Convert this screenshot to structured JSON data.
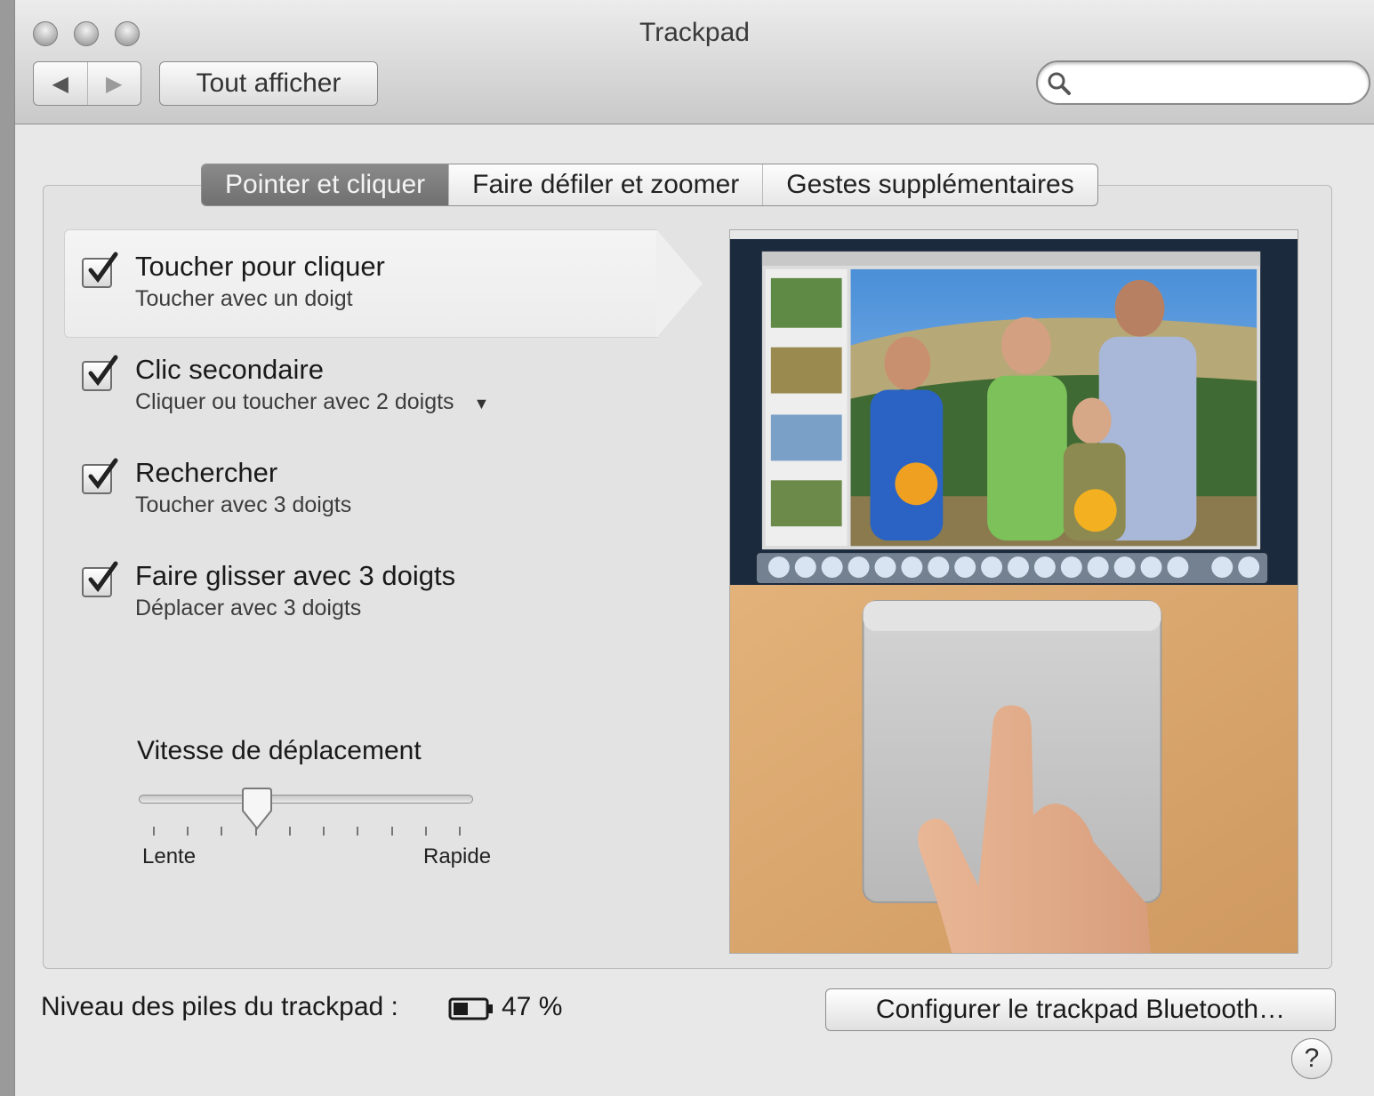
{
  "window": {
    "title": "Trackpad"
  },
  "toolbar": {
    "back_glyph": "◀",
    "forward_glyph": "▶",
    "show_all_label": "Tout afficher",
    "search_placeholder": "",
    "search_icon": "magnifier-icon"
  },
  "tabs": [
    {
      "label": "Pointer et cliquer",
      "active": true
    },
    {
      "label": "Faire défiler et zoomer",
      "active": false
    },
    {
      "label": "Gestes supplémentaires",
      "active": false
    }
  ],
  "options": [
    {
      "title": "Toucher pour cliquer",
      "subtitle": "Toucher avec un doigt",
      "checked": true,
      "selected": true
    },
    {
      "title": "Clic secondaire",
      "subtitle": "Cliquer ou toucher avec 2 doigts",
      "checked": true,
      "has_dropdown": true
    },
    {
      "title": "Rechercher",
      "subtitle": "Toucher avec 3 doigts",
      "checked": true
    },
    {
      "title": "Faire glisser avec 3 doigts",
      "subtitle": "Déplacer avec 3 doigts",
      "checked": true
    }
  ],
  "speed": {
    "label": "Vitesse de déplacement",
    "min_label": "Lente",
    "max_label": "Rapide",
    "ticks": 10,
    "value_fraction": 0.34
  },
  "battery": {
    "label": "Niveau des piles du trackpad :",
    "percent_text": "47 %",
    "level": 0.47
  },
  "buttons": {
    "bluetooth_setup": "Configurer le trackpad Bluetooth…",
    "help": "?"
  },
  "colors": {
    "active_tab": "#7c7c7c",
    "wood": "#d9a56a",
    "trackpad": "#c4c4c4"
  }
}
